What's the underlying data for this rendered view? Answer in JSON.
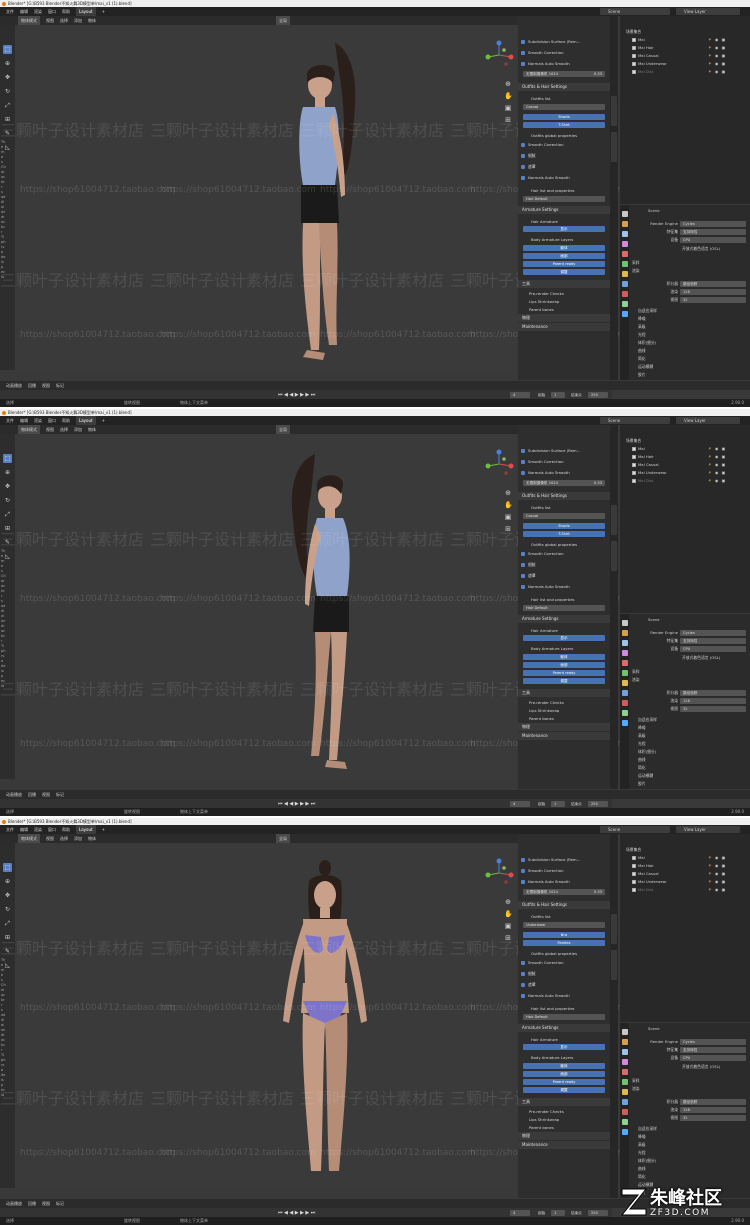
{
  "window": {
    "title": "Blender* [G:\\B593  Blender不知火舞3D模型单\\mai_v1 (1).blend]"
  },
  "menu": {
    "items": [
      "文件",
      "编辑",
      "渲染",
      "窗口",
      "帮助"
    ],
    "active_tab": "Layout",
    "add_tab": "+"
  },
  "scene_selector": {
    "label": "Scene"
  },
  "view_layer_selector": {
    "label": "View Layer"
  },
  "viewport_header": {
    "mode": "物体模式",
    "items": [
      "视图",
      "选择",
      "添加",
      "物体"
    ],
    "transform": "全局"
  },
  "left_tool_labels": [
    "Th",
    "e",
    "m",
    "e",
    "s",
    "Ch",
    "ar",
    "ac",
    "te",
    "r",
    "s",
    "ad",
    "di",
    "al",
    "wi",
    "dr",
    "ac",
    "to",
    "r",
    "Ti",
    "ph",
    "rs",
    "a",
    "de",
    "is",
    "p",
    "ec",
    "la"
  ],
  "side_tabs": [
    "SimpleBlender 4",
    "Mairuvid"
  ],
  "npanels": [
    {
      "top_rows": [
        "Subdivision Surface (Rem...",
        "Smooth Correction",
        "Normals Auto Smooth"
      ],
      "camera_field": {
        "label": "无限制摄像机 1024",
        "value": "0.33"
      },
      "outfits_section": "Outfits & Hair Settings",
      "outfits_list_label": "Outfits list",
      "outfit_value": "Casual",
      "outfit_buttons": [
        "Shorts",
        "T-Shirt"
      ],
      "outfits_global": "Outfits global properties",
      "global_rows": [
        "Smooth Correction",
        "细腻",
        "遮罩",
        "Normals Auto Smooth"
      ],
      "hair_list": "Hair list and properties",
      "hair_value": "Hair Default",
      "armature_section": "Armature Settings",
      "hair_armature": "Hair Armature",
      "hair_btn": "显示",
      "body_layers": "Body Armature Layers",
      "body_buttons": [
        "躯体",
        "面部",
        "Parent ready",
        "调整"
      ],
      "tools_section": "工具",
      "tool_rows": [
        "Pre-render Checks",
        "Lips Shrinkwrap",
        "Parent bones"
      ],
      "extra_section": "物理",
      "maintenance_section": "Maintenance"
    },
    {
      "top_rows": [
        "Subdivision Surface (Rem...",
        "Smooth Correction",
        "Normals Auto Smooth"
      ],
      "camera_field": {
        "label": "无限制摄像机 1024",
        "value": "0.33"
      },
      "outfits_section": "Outfits & Hair Settings",
      "outfits_list_label": "Outfits list",
      "outfit_value": "Casual",
      "outfit_buttons": [
        "Shorts",
        "T-Shirt"
      ],
      "outfits_global": "Outfits global properties",
      "global_rows": [
        "Smooth Correction",
        "细腻",
        "遮罩",
        "Normals Auto Smooth"
      ],
      "hair_list": "Hair list and properties",
      "hair_value": "Hair Default",
      "armature_section": "Armature Settings",
      "hair_armature": "Hair Armature",
      "hair_btn": "显示",
      "body_layers": "Body Armature Layers",
      "body_buttons": [
        "躯体",
        "面部",
        "Parent ready",
        "调整"
      ],
      "tools_section": "工具",
      "tool_rows": [
        "Pre-render Checks",
        "Lips Shrinkwrap",
        "Parent bones"
      ],
      "extra_section": "物理",
      "maintenance_section": "Maintenance"
    },
    {
      "top_rows": [
        "Subdivision Surface (Rem...",
        "Smooth Correction",
        "Normals Auto Smooth"
      ],
      "camera_field": {
        "label": "无限制摄像机 1024",
        "value": "0.33"
      },
      "outfits_section": "Outfits & Hair Settings",
      "outfits_list_label": "Outfits list",
      "outfit_value": "Underwear",
      "outfit_buttons": [
        "Bra",
        "Panties"
      ],
      "outfits_global": "Outfits global properties",
      "global_rows": [
        "Smooth Correction",
        "细腻",
        "遮罩",
        "Normals Auto Smooth"
      ],
      "hair_list": "Hair list and properties",
      "hair_value": "Hair Default",
      "armature_section": "Armature Settings",
      "hair_armature": "Hair Armature",
      "hair_btn": "显示",
      "body_layers": "Body Armature Layers",
      "body_buttons": [
        "躯体",
        "面部",
        "Parent ready",
        "调整"
      ],
      "tools_section": "工具",
      "tool_rows": [
        "Pre-render Checks",
        "Lips Shrinkwrap",
        "Parent bones"
      ],
      "extra_section": "物理",
      "maintenance_section": "Maintenance"
    }
  ],
  "outliner": {
    "title": "场景集合",
    "rows": [
      {
        "label": "Mai",
        "dim": false
      },
      {
        "label": "Mai Hair",
        "dim": false
      },
      {
        "label": "Mai Casual",
        "dim": false
      },
      {
        "label": "Mai Underwear",
        "dim": false
      },
      {
        "label": "Mai Dist",
        "dim": true
      }
    ]
  },
  "properties": {
    "title": "Scene",
    "render_engine_label": "Render Engine",
    "render_engine_value": "Cycles",
    "feature_set_label": "特征集",
    "feature_set_value": "支持特性",
    "device_label": "设备",
    "device_value": "CPU",
    "osl_label": "开放式着色语言 (OSL)",
    "sampling": "采样",
    "sampling_sub": "渲染",
    "integrator_label": "积分器",
    "integrator_value": "路径追踪",
    "render_label": "渲染",
    "render_value": "128",
    "viewport_label": "视图",
    "viewport_value": "32",
    "rows": [
      "自适应采样",
      "降噪",
      "高级",
      "光程",
      "体积(细分)",
      "曲线",
      "简化",
      "运动模糊",
      "胶片"
    ]
  },
  "bottombar": {
    "items": [
      "动画播放",
      "回播",
      "视图",
      "标记"
    ]
  },
  "timeline": {
    "start_label": "起始",
    "start": "1",
    "end_label": "结束点",
    "end": "250",
    "frame": "4"
  },
  "statusbar": {
    "left": "选择",
    "mid": "旋转视图",
    "right": "物体上下文菜单",
    "version": "2.90.0"
  },
  "watermarks": {
    "cn": "三颗叶子设计素材店",
    "url": "https://shop61004712.taobao.com"
  },
  "footer_logo": {
    "name": "朱峰社区",
    "url": "ZF3D.COM"
  }
}
